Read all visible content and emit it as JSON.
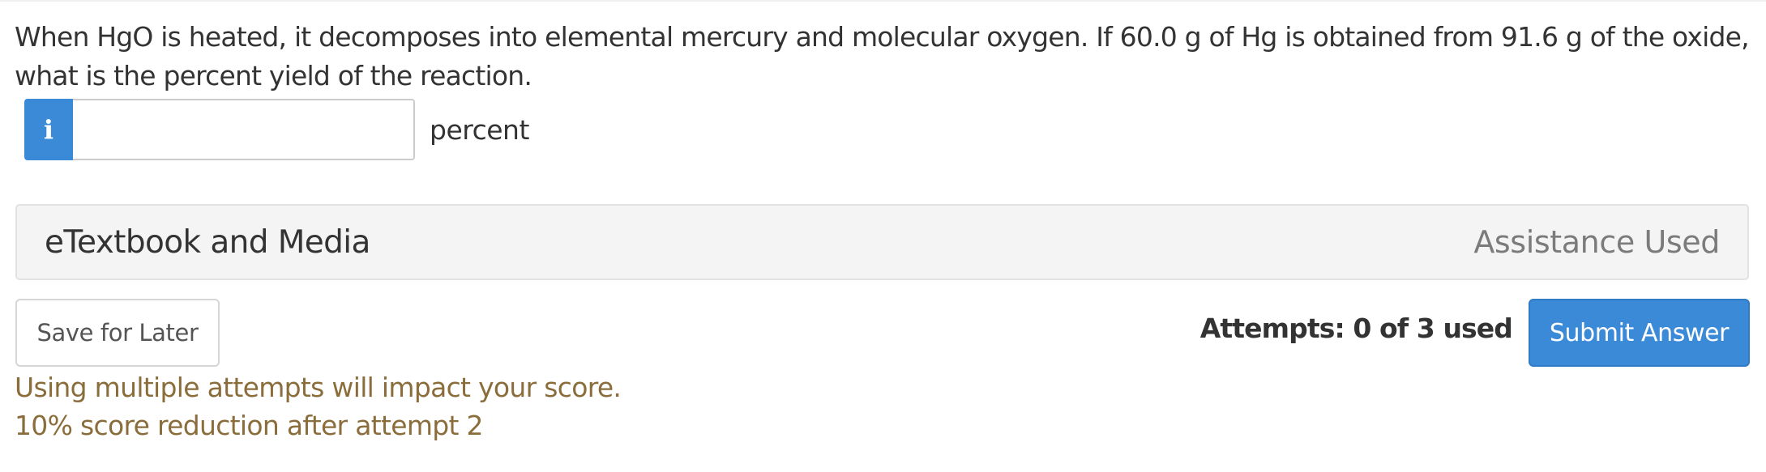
{
  "question": {
    "text": "When HgO is heated, it decomposes into elemental mercury and molecular oxygen. If 60.0 g of Hg is obtained from 91.6 g of the oxide, what is the percent yield of the reaction."
  },
  "answer": {
    "info_icon": "info-icon",
    "value": "",
    "unit": "percent"
  },
  "media_bar": {
    "title": "eTextbook and Media",
    "assistance": "Assistance Used"
  },
  "actions": {
    "save_label": "Save for Later",
    "attempts": "Attempts: 0 of 3 used",
    "submit_label": "Submit Answer"
  },
  "notices": {
    "line1": "Using multiple attempts will impact your score.",
    "line2": "10% score reduction after attempt 2"
  },
  "colors": {
    "accent": "#3a8ad8",
    "notice": "#8a6d3b"
  }
}
